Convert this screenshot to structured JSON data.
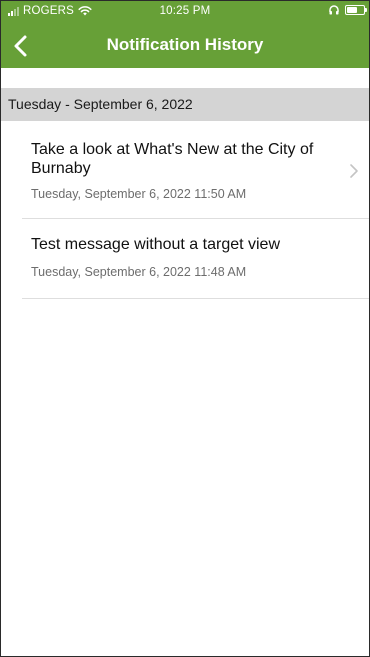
{
  "status_bar": {
    "carrier": "ROGERS",
    "time": "10:25 PM",
    "signal_icon": "cellular-signal-icon",
    "wifi_icon": "wifi-icon",
    "headphones_icon": "headphones-icon",
    "battery_icon": "battery-icon"
  },
  "nav": {
    "back_icon": "chevron-left-icon",
    "title": "Notification History"
  },
  "section": {
    "header": "Tuesday - September 6, 2022"
  },
  "notifications": [
    {
      "title": "Take a look at What's New at the City of Burnaby",
      "timestamp": "Tuesday, September 6, 2022 11:50 AM",
      "has_chevron": true
    },
    {
      "title": "Test message without a target view",
      "timestamp": "Tuesday, September 6, 2022 11:48 AM",
      "has_chevron": false
    }
  ],
  "colors": {
    "brand_green": "#67a037",
    "section_gray": "#d4d4d4",
    "secondary_text": "#6d6d6d"
  }
}
